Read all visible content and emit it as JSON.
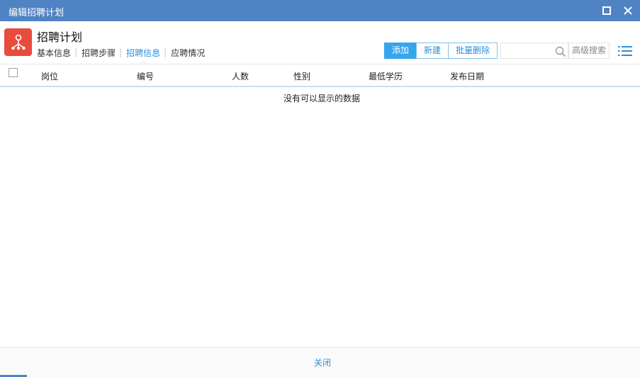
{
  "window": {
    "title": "编辑招聘计划",
    "maximize_icon": "maximize-icon",
    "close_icon": "close-icon"
  },
  "header": {
    "icon": "org-tree-icon",
    "title": "招聘计划",
    "tabs": [
      {
        "label": "基本信息",
        "active": false
      },
      {
        "label": "招聘步骤",
        "active": false
      },
      {
        "label": "招聘信息",
        "active": true
      },
      {
        "label": "应聘情况",
        "active": false
      }
    ],
    "tab_separator": "|"
  },
  "toolbar": {
    "add_label": "添加",
    "new_label": "新建",
    "batch_delete_label": "批量删除",
    "search_value": "",
    "search_placeholder": "",
    "advanced_search_label": "高级搜索",
    "list_icon": "list-icon"
  },
  "grid": {
    "columns": [
      "岗位",
      "编号",
      "人数",
      "性别",
      "最低学历",
      "发布日期"
    ],
    "rows": [],
    "empty_message": "没有可以显示的数据"
  },
  "footer": {
    "close_label": "关闭"
  },
  "colors": {
    "titlebar": "#4f83c4",
    "accent": "#35a5ee",
    "link": "#2b8fd6",
    "app_icon": "#e84c3d"
  }
}
